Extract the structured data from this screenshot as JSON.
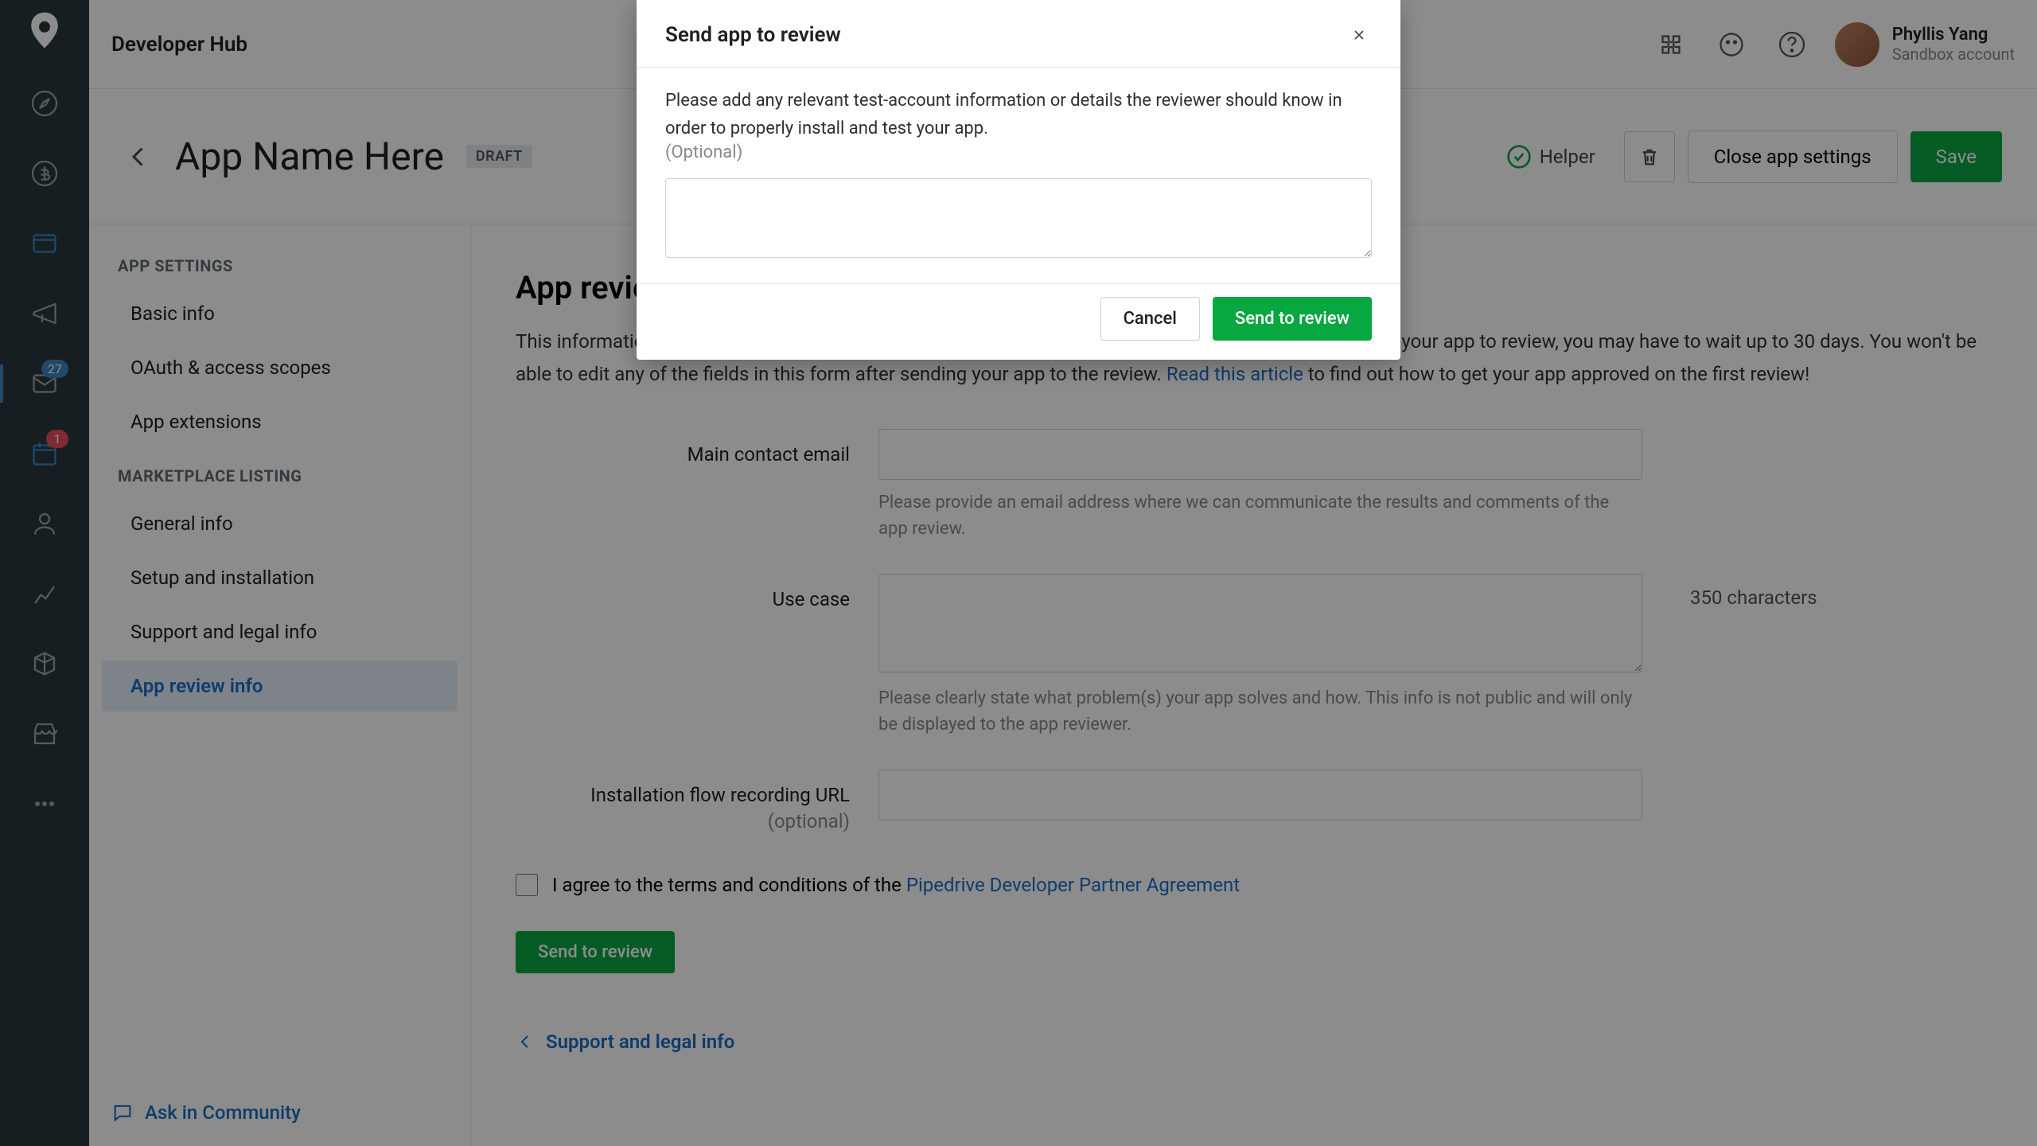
{
  "modal": {
    "title": "Send app to review",
    "desc": "Please add any relevant test-account information or details the reviewer should know in order to properly install and test your app.",
    "optional": "(Optional)",
    "cancel": "Cancel",
    "send": "Send to review"
  },
  "top": {
    "title": "Developer Hub",
    "user_name": "Phyllis Yang",
    "user_sub": "Sandbox account"
  },
  "rail": {
    "badge_inbox": "27",
    "badge_cal": "1"
  },
  "subheader": {
    "app_name": "App Name Here",
    "draft": "DRAFT",
    "helper": "Helper",
    "close": "Close app settings",
    "save": "Save"
  },
  "nav": {
    "section1": "APP SETTINGS",
    "basic": "Basic info",
    "oauth": "OAuth & access scopes",
    "ext": "App extensions",
    "section2": "MARKETPLACE LISTING",
    "general": "General info",
    "setup": "Setup and installation",
    "support": "Support and legal info",
    "review": "App review info",
    "ask": "Ask in Community"
  },
  "main": {
    "title": "App review info",
    "desc1": "This information will only be visible to the app reviewer, please be as specific as possible. After you send your app to review, you may have to wait up to 30 days. You won't be able to edit any of the fields in this form after sending your app to the review. ",
    "read_link": "Read this article",
    "desc2": " to find out how to get your app approved on the first review!",
    "label_email": "Main contact email",
    "help_email": "Please provide an email address where we can communicate the results and comments of the app review.",
    "label_usecase": "Use case",
    "chars": "350 characters",
    "help_usecase": "Please clearly state what problem(s) your app solves and how. This info is not public and will only be displayed to the app reviewer.",
    "label_install": "Installation flow recording URL",
    "label_install_opt": "(optional)",
    "agree_pre": "I agree to the terms and conditions of the ",
    "agree_link": "Pipedrive Developer Partner Agreement",
    "send_btn": "Send to review",
    "bottom_nav": "Support and legal info"
  }
}
